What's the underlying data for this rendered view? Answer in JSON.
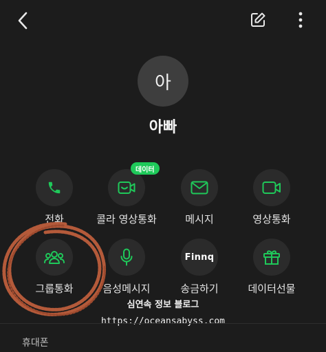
{
  "contact": {
    "avatar_text": "아",
    "name": "아빠"
  },
  "actions": [
    {
      "label": "전화",
      "icon": "phone-icon"
    },
    {
      "label": "콜라 영상통화",
      "icon": "video-call-icon",
      "badge": "데이터"
    },
    {
      "label": "메시지",
      "icon": "message-icon"
    },
    {
      "label": "영상통화",
      "icon": "video-camera-icon"
    },
    {
      "label": "그룹통화",
      "icon": "group-icon"
    },
    {
      "label": "음성메시지",
      "icon": "microphone-icon"
    },
    {
      "label": "송금하기",
      "icon": "finnq-logo",
      "icon_text": "Finnq"
    },
    {
      "label": "데이터선물",
      "icon": "gift-icon"
    }
  ],
  "watermark": {
    "title": "심연속 정보 블로그",
    "url": "https://oceansabyss.com"
  },
  "phone_section": {
    "label": "휴대폰"
  },
  "colors": {
    "background": "#1c1c1c",
    "accent": "#1fc95a",
    "circle": "#2b2b2b",
    "scribble": "#b45a3a"
  }
}
